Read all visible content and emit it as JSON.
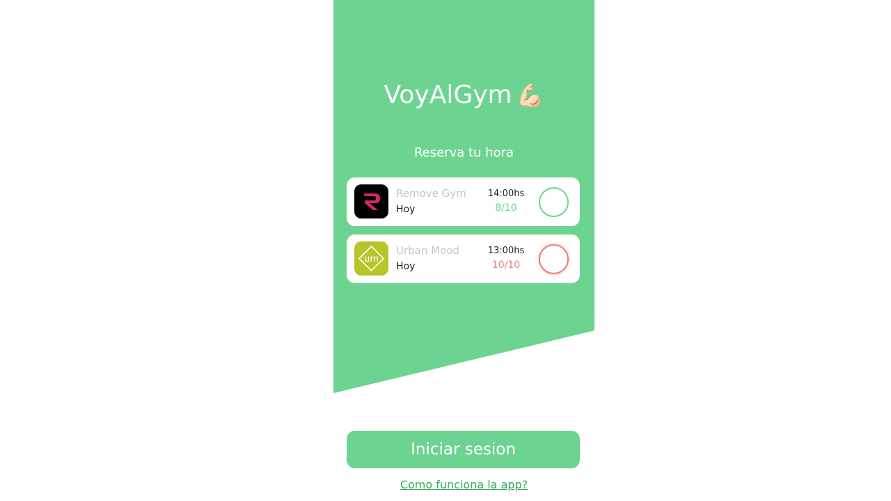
{
  "app": {
    "title": "VoyAlGym",
    "title_emoji": "💪🏻"
  },
  "booking": {
    "heading": "Reserva tu hora",
    "gyms": [
      {
        "name": "Remove Gym",
        "day": "Hoy",
        "time": "14:00hs",
        "slots": "8/10",
        "status": "available",
        "logo_icon": "remove-gym-logo"
      },
      {
        "name": "Urban Mood",
        "day": "Hoy",
        "time": "13:00hs",
        "slots": "10/10",
        "status": "full",
        "logo_icon": "urban-mood-logo"
      }
    ]
  },
  "actions": {
    "login_label": "Iniciar sesion",
    "help_link": "Como funciona la app?"
  },
  "colors": {
    "brand_green": "#6cd490",
    "available": "#6cd490",
    "full": "#f07a7a",
    "link": "#3aa85e"
  }
}
